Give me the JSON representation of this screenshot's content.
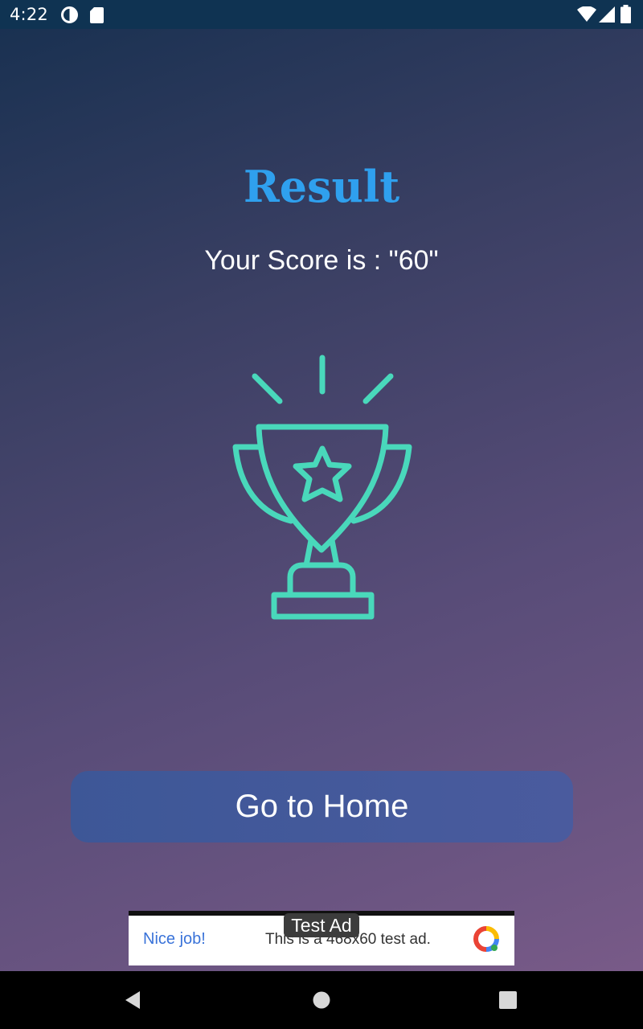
{
  "status_bar": {
    "time": "4:22",
    "left_icons": [
      "data-saver-icon",
      "sd-card-icon"
    ],
    "right_icons": [
      "wifi-icon",
      "signal-icon",
      "battery-icon"
    ]
  },
  "result": {
    "title": "Result",
    "score_text": "Your Score is : \"60\"",
    "trophy_icon": "trophy-icon",
    "accent_color": "#49d8bb",
    "title_color": "#2fa0ee"
  },
  "home_button": {
    "label": "Go to Home"
  },
  "ad": {
    "label": "Test Ad",
    "headline": "Nice job!",
    "description": "This is a 468x60 test ad.",
    "logo_icon": "ad-logo-icon"
  },
  "nav_bar": {
    "buttons": [
      "back-icon",
      "home-icon",
      "recents-icon"
    ]
  }
}
